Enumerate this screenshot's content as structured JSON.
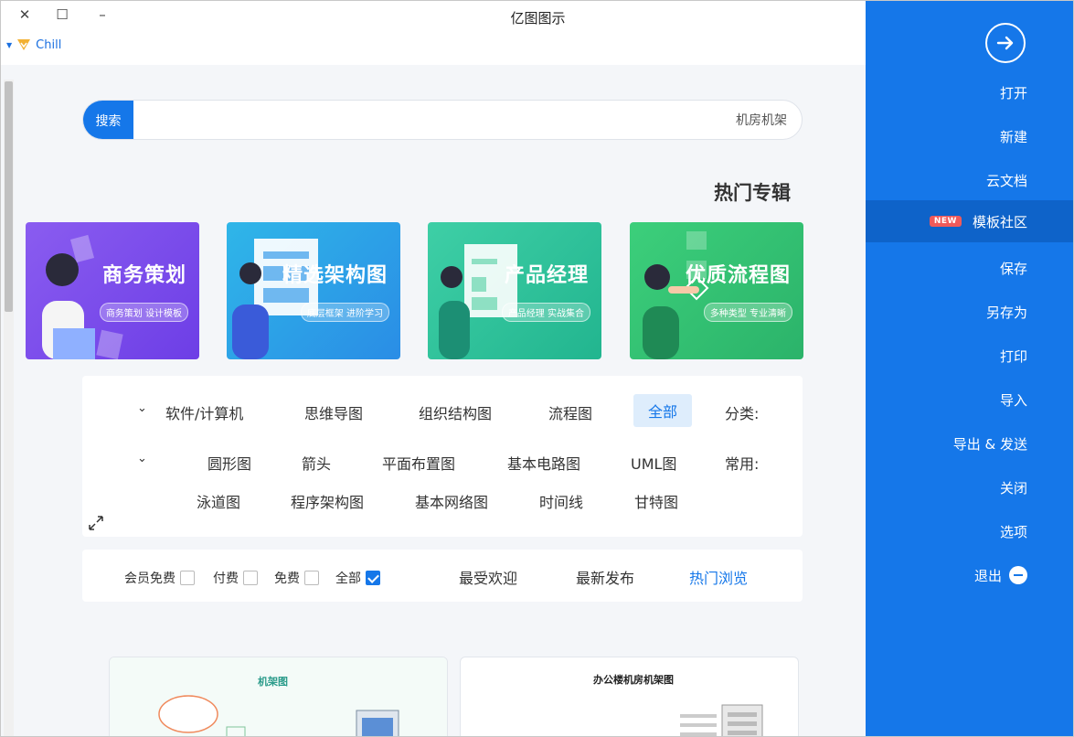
{
  "window": {
    "title": "亿图图示",
    "user_name": "Chill"
  },
  "sidebar": {
    "items": [
      {
        "label": "打开"
      },
      {
        "label": "新建"
      },
      {
        "label": "云文档"
      },
      {
        "label": "模板社区",
        "badge": "NEW"
      },
      {
        "label": "保存"
      },
      {
        "label": "另存为"
      },
      {
        "label": "打印"
      },
      {
        "label": "导入"
      },
      {
        "label": "导出 & 发送"
      },
      {
        "label": "关闭"
      },
      {
        "label": "选项"
      },
      {
        "label": "退出"
      }
    ]
  },
  "search": {
    "button_label": "搜索",
    "value": "机房机架"
  },
  "hot_section": {
    "title": "热门专辑",
    "banners": [
      {
        "title": "优质流程图",
        "subtitle": "多种类型 专业清晰"
      },
      {
        "title": "产品经理",
        "subtitle": "产品经理 实战集合"
      },
      {
        "title": "精选架构图",
        "subtitle": "底层框架 进阶学习"
      },
      {
        "title": "商务策划",
        "subtitle": "商务策划 设计模板"
      }
    ]
  },
  "filters": {
    "category_label": "分类:",
    "categories": [
      "全部",
      "流程图",
      "组织结构图",
      "思维导图",
      "软件/计算机"
    ],
    "common_label": "常用:",
    "common_row1": [
      "UML图",
      "基本电路图",
      "平面布置图",
      "箭头",
      "圆形图"
    ],
    "common_row2": [
      "甘特图",
      "时间线",
      "基本网络图",
      "程序架构图",
      "泳道图"
    ]
  },
  "sort": {
    "tabs": [
      "热门浏览",
      "最新发布",
      "最受欢迎"
    ],
    "checks": [
      {
        "label": "全部",
        "checked": true
      },
      {
        "label": "免费",
        "checked": false
      },
      {
        "label": "付费",
        "checked": false
      },
      {
        "label": "会员免费",
        "checked": false
      }
    ]
  },
  "cards": [
    {
      "title": "办公楼机房机架图"
    },
    {
      "title": "机架图"
    }
  ],
  "colors": {
    "accent": "#1577e9",
    "sidebar_active": "#0e63c9",
    "new_badge": "#f05a5a"
  }
}
